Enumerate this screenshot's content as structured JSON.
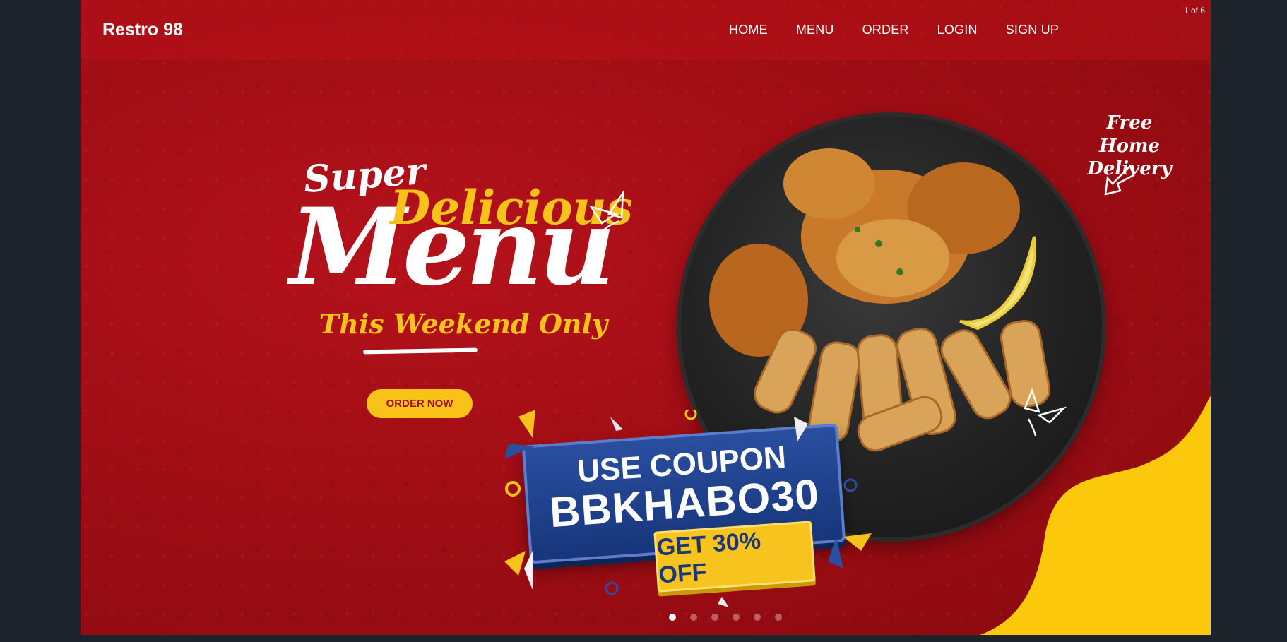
{
  "navbar": {
    "brand": "Restro 98",
    "links": [
      "HOME",
      "MENU",
      "ORDER",
      "LOGIN",
      "SIGN UP"
    ]
  },
  "slideshow": {
    "counter": "1 of 6",
    "dots_total": 6,
    "active_dot": 1,
    "next_icon": "chevron-right-icon"
  },
  "hero": {
    "headline_super": "Super",
    "headline_delicious": "Delicious",
    "headline_menu": "Menu",
    "headline_subtitle": "This Weekend Only",
    "cta_label": "ORDER NOW",
    "delivery_note_line1": "Free Home",
    "delivery_note_line2": "Delivery",
    "coupon_line1": "USE COUPON",
    "coupon_code": "BBKHABO30",
    "discount_label": "GET 30% OFF"
  },
  "colors": {
    "background_red": "#a00d14",
    "accent_yellow": "#f9c218",
    "coupon_blue": "#1f418e",
    "page_bg": "#1c232a"
  }
}
